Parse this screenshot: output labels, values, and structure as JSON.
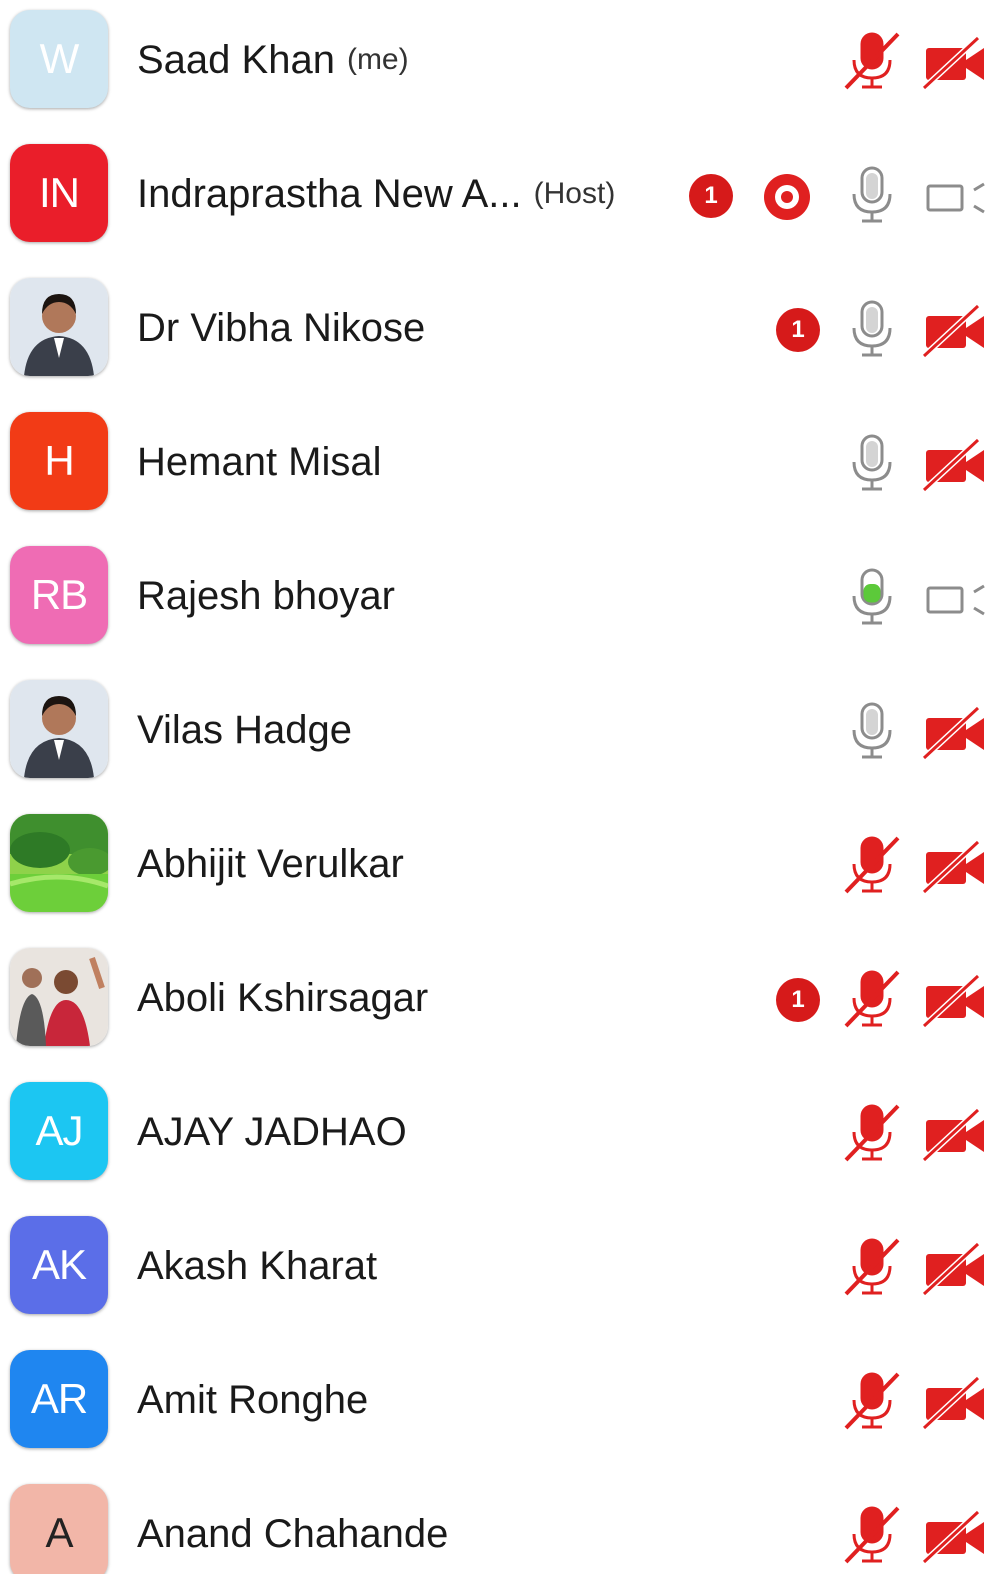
{
  "colors": {
    "muted_red": "#e02020",
    "mic_gray": "#8c8c8c",
    "mic_active_green": "#5cc93a",
    "badge_red": "#d61a1a"
  },
  "participants": [
    {
      "name": "Saad Khan",
      "tag": "(me)",
      "avatar_text": "W",
      "avatar_color": "#cfe6f2",
      "avatar_text_color": "#ffffff",
      "mic": "muted",
      "video": "off",
      "badge": ""
    },
    {
      "name": "Indraprastha New A...",
      "tag": "(Host)",
      "avatar_text": "IN",
      "avatar_color": "#ea1e2a",
      "avatar_text_color": "#ffffff",
      "mic": "on",
      "video": "on",
      "badge": "1",
      "recording": true
    },
    {
      "name": "Dr Vibha Nikose",
      "tag": "",
      "avatar_text": "",
      "avatar_photo": "person-photo",
      "mic": "on",
      "video": "off",
      "badge": "1"
    },
    {
      "name": "Hemant Misal",
      "tag": "",
      "avatar_text": "H",
      "avatar_color": "#f23b16",
      "avatar_text_color": "#ffffff",
      "mic": "on",
      "video": "off",
      "badge": ""
    },
    {
      "name": "Rajesh bhoyar",
      "tag": "",
      "avatar_text": "RB",
      "avatar_color": "#ef6cb4",
      "avatar_text_color": "#ffffff",
      "mic": "speaking",
      "video": "on",
      "badge": ""
    },
    {
      "name": "Vilas Hadge",
      "tag": "",
      "avatar_text": "",
      "avatar_photo": "person-photo",
      "mic": "on",
      "video": "off",
      "badge": ""
    },
    {
      "name": "Abhijit Verulkar",
      "tag": "",
      "avatar_text": "",
      "avatar_photo": "landscape-photo",
      "mic": "muted",
      "video": "off",
      "badge": ""
    },
    {
      "name": "Aboli Kshirsagar",
      "tag": "",
      "avatar_text": "",
      "avatar_photo": "group-photo",
      "mic": "muted",
      "video": "off",
      "badge": "1"
    },
    {
      "name": "AJAY JADHAO",
      "tag": "",
      "avatar_text": "AJ",
      "avatar_color": "#1cc6f2",
      "avatar_text_color": "#ffffff",
      "mic": "muted",
      "video": "off",
      "badge": ""
    },
    {
      "name": "Akash Kharat",
      "tag": "",
      "avatar_text": "AK",
      "avatar_color": "#5b6ee8",
      "avatar_text_color": "#ffffff",
      "mic": "muted",
      "video": "off",
      "badge": ""
    },
    {
      "name": "Amit Ronghe",
      "tag": "",
      "avatar_text": "AR",
      "avatar_color": "#1f86f0",
      "avatar_text_color": "#ffffff",
      "mic": "muted",
      "video": "off",
      "badge": ""
    },
    {
      "name": "Anand Chahande",
      "tag": "",
      "avatar_text": "A",
      "avatar_color": "#f2b6a8",
      "avatar_text_color": "#222222",
      "mic": "muted",
      "video": "off",
      "badge": ""
    }
  ]
}
